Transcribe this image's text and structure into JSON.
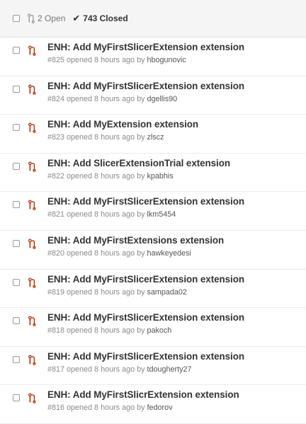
{
  "header": {
    "open_label": "2 Open",
    "closed_label": "743 Closed",
    "closed_check": "✔"
  },
  "colors": {
    "pr_icon": "#bd2c00",
    "header_bg": "#f5f5f5"
  },
  "pulls": [
    {
      "title": "ENH: Add MyFirstSlicerExtension extension",
      "number": "#825",
      "opened": "opened 8 hours ago by",
      "author": "hbogunovic"
    },
    {
      "title": "ENH: Add MyFirstSlicerExtension extension",
      "number": "#824",
      "opened": "opened 8 hours ago by",
      "author": "dgellis90"
    },
    {
      "title": "ENH: Add MyExtension extension",
      "number": "#823",
      "opened": "opened 8 hours ago by",
      "author": "zlscz"
    },
    {
      "title": "ENH: Add SlicerExtensionTrial extension",
      "number": "#822",
      "opened": "opened 8 hours ago by",
      "author": "kpabhis"
    },
    {
      "title": "ENH: Add MyFirstSlicerExtension extension",
      "number": "#821",
      "opened": "opened 8 hours ago by",
      "author": "lkm5454"
    },
    {
      "title": "ENH: Add MyFirstExtensions extension",
      "number": "#820",
      "opened": "opened 8 hours ago by",
      "author": "hawkeyedesi"
    },
    {
      "title": "ENH: Add MyFirstSlicerExtension extension",
      "number": "#819",
      "opened": "opened 8 hours ago by",
      "author": "sampada02"
    },
    {
      "title": "ENH: Add MyFirstSlicerExtension extension",
      "number": "#818",
      "opened": "opened 8 hours ago by",
      "author": "pakoch"
    },
    {
      "title": "ENH: Add MyFirstSlicerExtension extension",
      "number": "#817",
      "opened": "opened 8 hours ago by",
      "author": "tdougherty27"
    },
    {
      "title": "ENH: Add MyFirstSlicrExtension extension",
      "number": "#816",
      "opened": "opened 8 hours ago by",
      "author": "fedorov"
    }
  ]
}
